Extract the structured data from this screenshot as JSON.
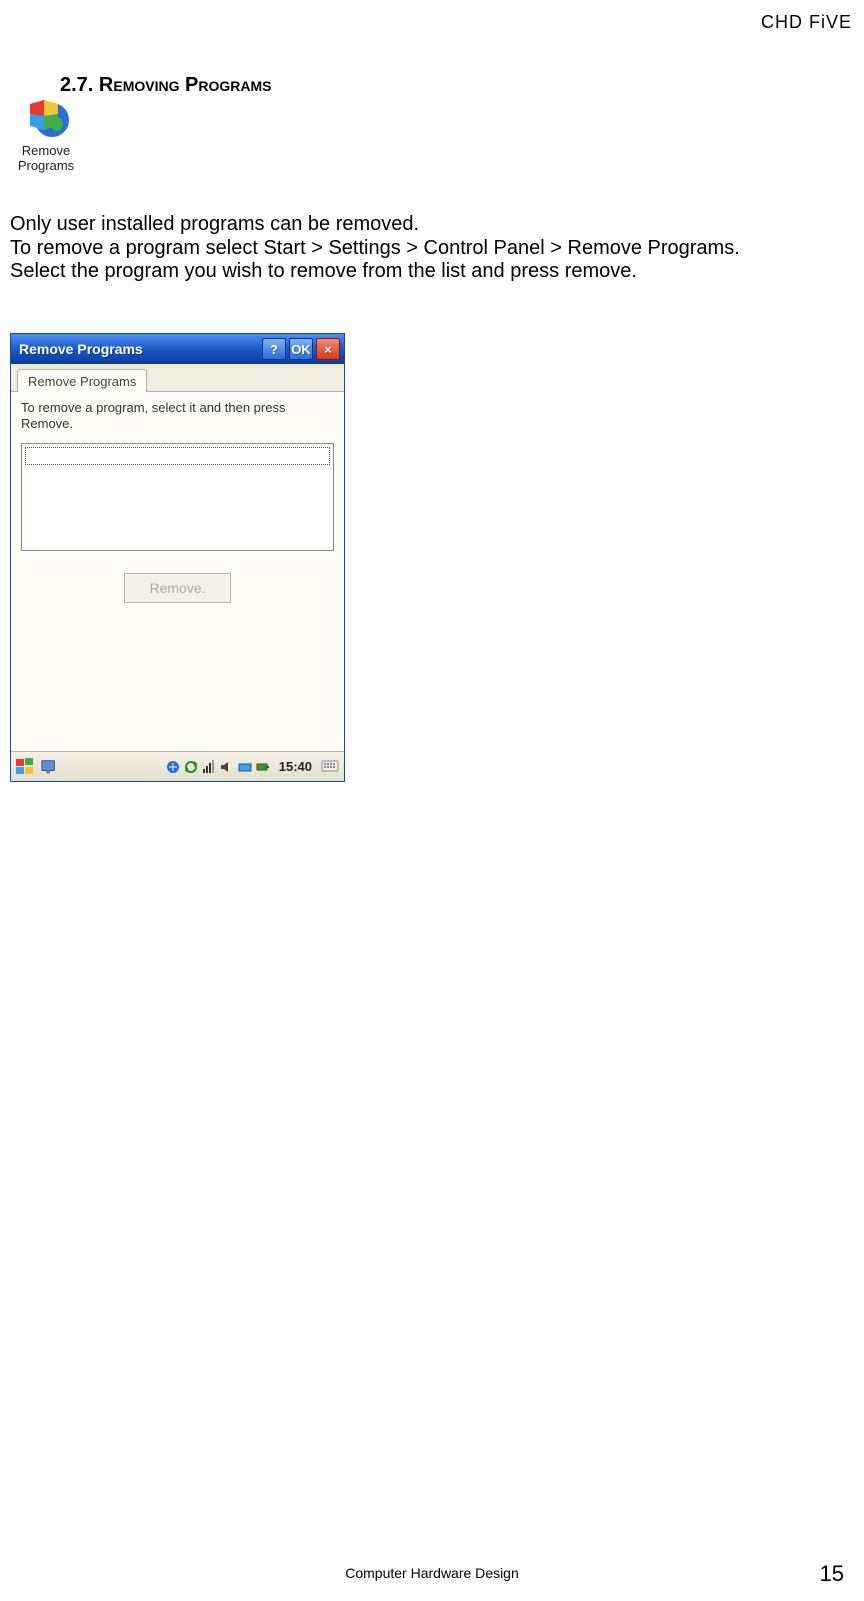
{
  "header": {
    "brand": "CHD FiVE"
  },
  "section": {
    "number": "2.7.",
    "title_rest": "Removing Programs"
  },
  "icon": {
    "caption_line1": "Remove",
    "caption_line2": "Programs"
  },
  "body": {
    "p1": "Only user installed programs can be removed.",
    "p2": "To remove a program select Start > Settings > Control Panel > Remove Programs.",
    "p3": "Select the program you wish to remove from the list and press remove."
  },
  "dialog": {
    "title": "Remove Programs",
    "help_label": "?",
    "ok_label": "OK",
    "close_label": "×",
    "tab_label": "Remove Programs",
    "instruction": "To remove a program, select it and then press Remove.",
    "remove_button": "Remove.",
    "clock": "15:40"
  },
  "footer": {
    "center": "Computer Hardware Design",
    "page": "15"
  }
}
